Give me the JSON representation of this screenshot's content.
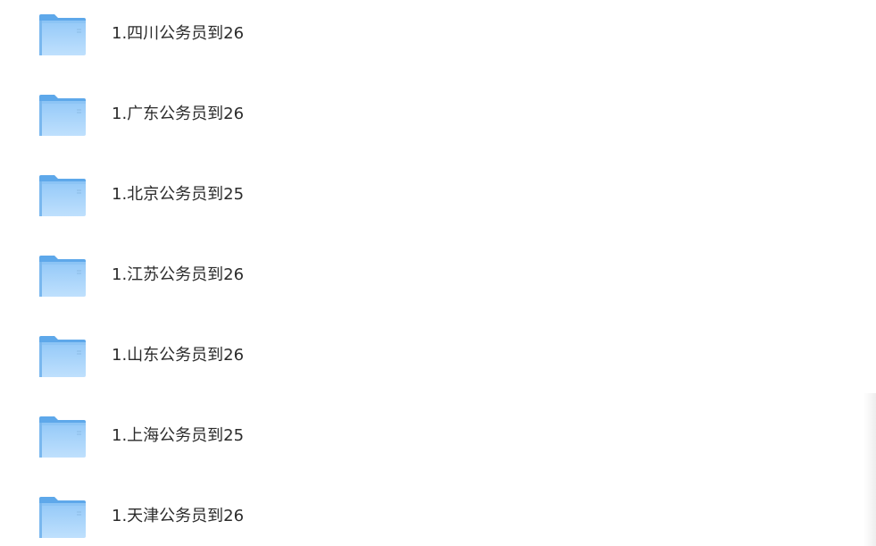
{
  "folders": [
    {
      "name": "1.四川公务员到26",
      "icon": "folder-icon"
    },
    {
      "name": "1.广东公务员到26",
      "icon": "folder-icon"
    },
    {
      "name": "1.北京公务员到25",
      "icon": "folder-icon"
    },
    {
      "name": "1.江苏公务员到26",
      "icon": "folder-icon"
    },
    {
      "name": "1.山东公务员到26",
      "icon": "folder-icon"
    },
    {
      "name": "1.上海公务员到25",
      "icon": "folder-icon"
    },
    {
      "name": "1.天津公务员到26",
      "icon": "folder-icon"
    }
  ],
  "colors": {
    "folder_light": "#a9d3fb",
    "folder_mid": "#80bff5",
    "folder_dark": "#5aa6ea",
    "text": "#2b2b2b",
    "background": "#ffffff"
  }
}
